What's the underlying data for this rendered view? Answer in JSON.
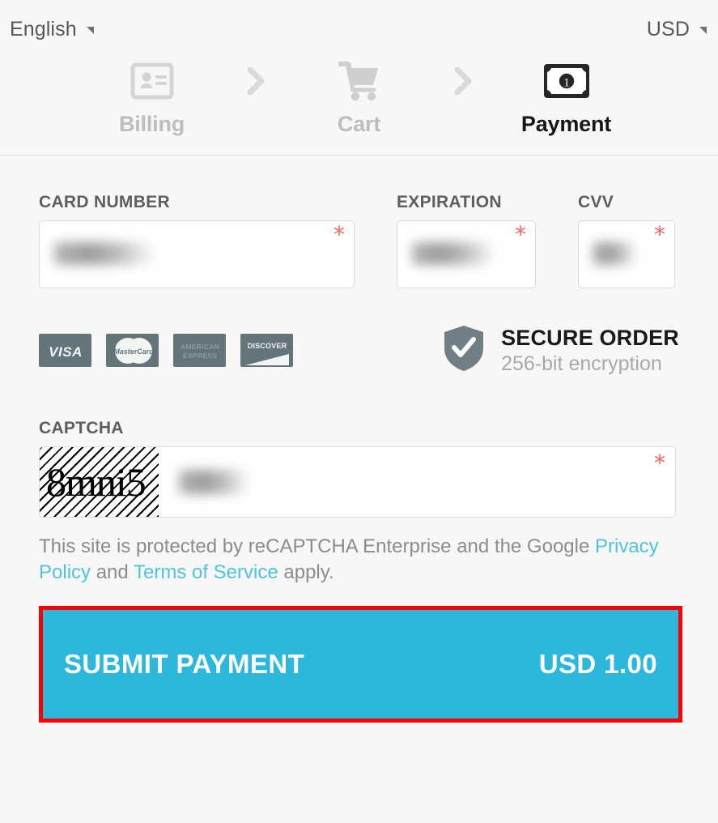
{
  "locale_bar": {
    "language": "English",
    "currency": "USD",
    "language_caret_icon": "triangle-down-icon",
    "currency_caret_icon": "triangle-down-icon"
  },
  "steps": [
    {
      "label": "Billing",
      "icon": "id-card-icon",
      "state": "done"
    },
    {
      "label": "Cart",
      "icon": "shopping-cart-icon",
      "state": "done"
    },
    {
      "label": "Payment",
      "icon": "banknote-icon",
      "state": "active"
    }
  ],
  "step_separator_icon": "chevron-right-icon",
  "form": {
    "card_number": {
      "label": "CARD NUMBER",
      "value": "",
      "redacted": true,
      "required": true,
      "required_marker": "*"
    },
    "expiration": {
      "label": "EXPIRATION",
      "value": "",
      "redacted": true,
      "required": true,
      "required_marker": "*"
    },
    "cvv": {
      "label": "CVV",
      "value": "",
      "redacted": true,
      "required": true,
      "required_marker": "*"
    },
    "captcha": {
      "label": "CAPTCHA",
      "challenge_text": "8mni5",
      "value": "",
      "redacted": true,
      "required": true,
      "required_marker": "*"
    }
  },
  "card_brands": [
    {
      "name": "VISA",
      "icon": "visa-logo"
    },
    {
      "name": "MasterCard",
      "icon": "mastercard-logo"
    },
    {
      "name": "AMERICAN EXPRESS",
      "icon": "amex-logo"
    },
    {
      "name": "DISCOVER",
      "icon": "discover-logo"
    }
  ],
  "secure_badge": {
    "icon": "shield-check-icon",
    "title": "SECURE ORDER",
    "subtitle": "256-bit encryption"
  },
  "recaptcha_notice": {
    "text_before": "This site is protected by reCAPTCHA Enterprise and the Google ",
    "privacy_link": "Privacy Policy",
    "text_middle": " and ",
    "terms_link": "Terms of Service",
    "text_after": " apply."
  },
  "submit": {
    "label": "SUBMIT PAYMENT",
    "amount": "USD 1.00"
  },
  "colors": {
    "page_background": "#f7f7f7",
    "submit_background": "#2bb8dc",
    "highlight_border": "#ff0000",
    "link": "#4ec3e0",
    "required_asterisk": "#f4635e",
    "brand_tile": "#64757a",
    "step_done_text": "#bdbdbd",
    "step_active_text": "#171717"
  }
}
